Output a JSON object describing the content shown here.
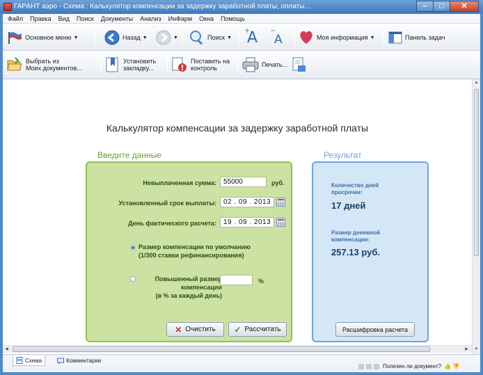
{
  "window": {
    "title": "ГАРАНТ аэро - Схема : Калькулятор компенсации за задержку заработной платы, оплаты..."
  },
  "menu": [
    "Файл",
    "Правка",
    "Вид",
    "Поиск",
    "Документы",
    "Анализ",
    "ИнФарм",
    "Окна",
    "Помощь"
  ],
  "toolbar1": {
    "main_menu": "Основное меню",
    "back": "Назад",
    "search": "Поиск",
    "my_info": "Моя информация",
    "task_panel": "Панель задач"
  },
  "toolbar2": {
    "choose_docs_line1": "Выбрать из",
    "choose_docs_line2": "Моих документов...",
    "bookmark_line1": "Установить",
    "bookmark_line2": "закладку...",
    "control_line1": "Поставить на",
    "control_line2": "контроль",
    "print": "Печать..."
  },
  "page": {
    "title": "Калькулятор компенсации за задержку заработной платы",
    "input_section": "Введите данные",
    "result_section": "Результат"
  },
  "form": {
    "unpaid_label": "Невыплаченная сумма:",
    "unpaid_value": "55000",
    "unpaid_unit": "руб.",
    "due_label": "Установленный срок выплаты:",
    "due_value": "02 . 09 . 2013",
    "calc_date_label": "День фактического расчета:",
    "calc_date_value": "19 . 09 . 2013",
    "radio_default_line1": "Размер компенсации по умолчанию",
    "radio_default_line2": "(1/300 ставки рефинансирования)",
    "radio_increased_line1": "Повышенный размер",
    "radio_increased_line2": "компенсации",
    "radio_increased_line3": "(в % за каждый день)",
    "increased_value": "",
    "percent_unit": "%",
    "clear_button": "Очистить",
    "calc_button": "Рассчитать"
  },
  "result": {
    "days_label_line1": "Количество дней",
    "days_label_line2": "просрочки:",
    "days_value": "17 дней",
    "comp_label_line1": "Размер денежной",
    "comp_label_line2": "компенсации:",
    "comp_value": "257.13 руб.",
    "details_button": "Расшифровка расчета"
  },
  "tabs": {
    "scheme": "Схема",
    "comments": "Комментарии"
  },
  "status": {
    "useful": "Полезен ли документ?"
  },
  "colors": {
    "input_panel": "#cbe2a3",
    "input_border": "#8fc14f",
    "result_panel": "#d4e7f7",
    "result_border": "#6aa4dc",
    "input_heading": "#6aa12a",
    "result_heading": "#6aa0d6"
  }
}
